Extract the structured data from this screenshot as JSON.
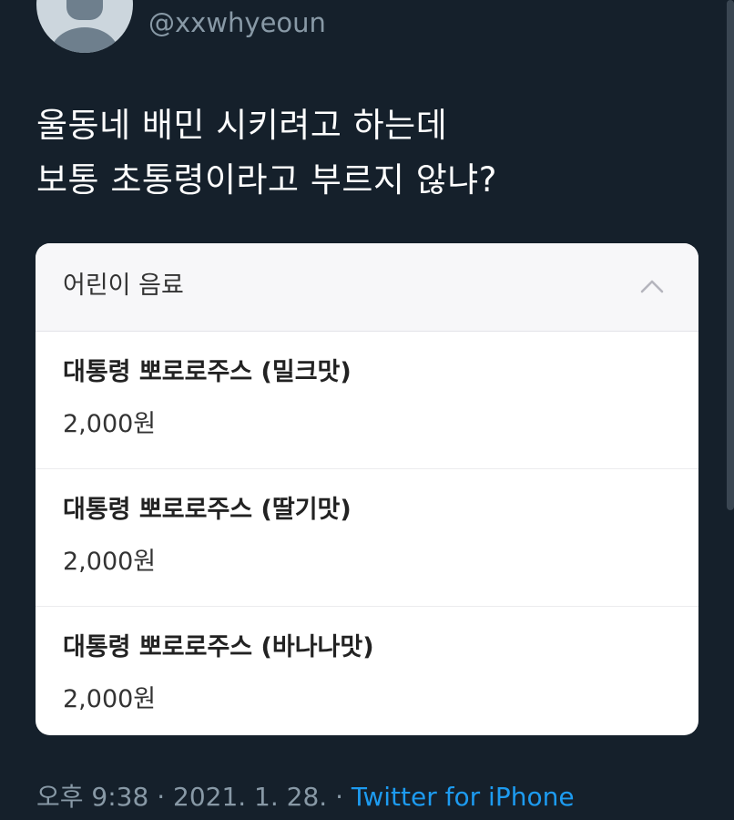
{
  "user": {
    "handle": "@xxwhyeoun"
  },
  "tweet": {
    "lines": [
      "울동네 배민 시키려고 하는데",
      "보통 초통령이라고 부르지 않냐?"
    ]
  },
  "card": {
    "section_title": "어린이 음료",
    "collapse_icon": "chevron-up-icon",
    "items": [
      {
        "name": "대통령 뽀로로주스 (밀크맛)",
        "price": "2,000원"
      },
      {
        "name": "대통령 뽀로로주스 (딸기맛)",
        "price": "2,000원"
      },
      {
        "name": "대통령 뽀로로주스 (바나나맛)",
        "price": "2,000원"
      }
    ]
  },
  "meta": {
    "time_date": "오후 9:38 · 2021. 1. 28. · ",
    "source": "Twitter for iPhone"
  },
  "colors": {
    "background": "#15202b",
    "handle_text": "#8899a6",
    "link": "#1d9bf0"
  }
}
